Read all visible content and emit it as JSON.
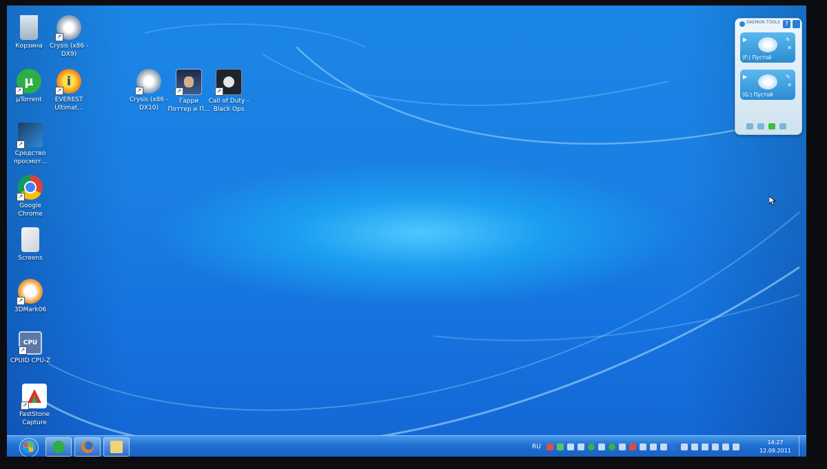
{
  "desktop": {
    "icons": [
      {
        "label": "Корзина",
        "icon": "recycle-bin-icon"
      },
      {
        "label": "Crysis (x86 -DX9)",
        "icon": "crysis-icon"
      },
      {
        "label": "µTorrent",
        "icon": "utorrent-icon"
      },
      {
        "label": "EVEREST Ultimat...",
        "icon": "everest-icon"
      },
      {
        "label": "Crysis (x86 -DX10)",
        "icon": "crysis-icon"
      },
      {
        "label": "Гарри Поттер и П...",
        "icon": "harry-potter-icon"
      },
      {
        "label": "Call of Duty - Black Ops",
        "icon": "call-of-duty-icon"
      },
      {
        "label": "Средство просмот...",
        "icon": "image-viewer-icon"
      },
      {
        "label": "Google Chrome",
        "icon": "chrome-icon"
      },
      {
        "label": "Screens",
        "icon": "folder-icon"
      },
      {
        "label": "3DMark06",
        "icon": "3dmark-icon"
      },
      {
        "label": "CPUID CPU-Z",
        "icon": "cpu-z-icon"
      },
      {
        "label": "FastStone Capture",
        "icon": "faststone-icon"
      }
    ]
  },
  "daemon_tools": {
    "logo": "DAEMON TOOLS",
    "help": "?",
    "drives": [
      {
        "label": "(F:) Пустой"
      },
      {
        "label": "(G:) Пустой"
      }
    ]
  },
  "taskbar": {
    "pinned": [
      "utorrent-icon",
      "firefox-icon",
      "explorer-icon"
    ],
    "language": "RU",
    "time": "14:27",
    "date": "12.09.2011"
  }
}
